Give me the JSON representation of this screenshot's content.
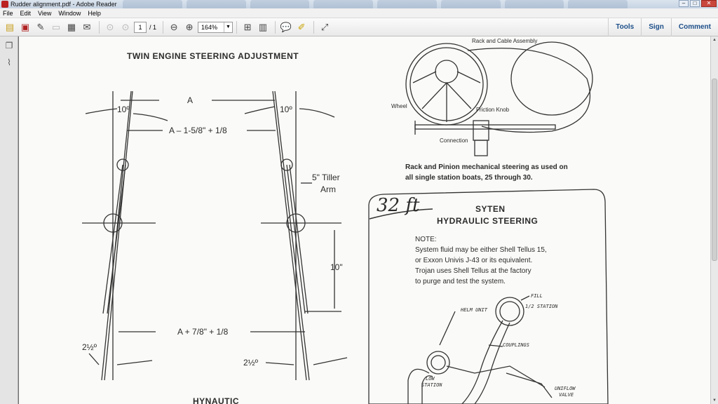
{
  "window": {
    "title": "Rudder alignment.pdf - Adobe Reader"
  },
  "menu": [
    "File",
    "Edit",
    "View",
    "Window",
    "Help"
  ],
  "toolbar": {
    "page_current": "1",
    "page_total": "/ 1",
    "zoom": "164%",
    "tools_label": "Tools",
    "sign_label": "Sign",
    "comment_label": "Comment"
  },
  "document": {
    "left_title": "TWIN ENGINE STEERING ADJUSTMENT",
    "dim_a": "A",
    "angle_top_left": "10º",
    "angle_top_right": "10º",
    "dim_a_minus": "A – 1-5/8\" + 1/8",
    "tiller_1": "5\" Tiller",
    "tiller_2": "Arm",
    "dim_10": "10\"",
    "dim_a_plus": "A + 7/8\" + 1/8",
    "angle_bottom_left": "2½º",
    "angle_bottom_right": "2½º",
    "bottom_cut": "HYNAUTIC",
    "rack_assembly": "Rack and Cable Assembly",
    "wheel": "Wheel",
    "friction_knob": "Friction Knob",
    "connection": "Connection",
    "rack_caption_1": "Rack and Pinion mechanical steering as used on",
    "rack_caption_2": "all single station boats, 25 through 30.",
    "handwritten": "32 ft",
    "box_title_1": "SYTEN",
    "box_title_2": "HYDRAULIC STEERING",
    "note_label": "NOTE:",
    "note_1": "System fluid may be either Shell Tellus 15,",
    "note_2": "or Exxon Univis J-43 or its equivalent.",
    "note_3": "Trojan uses Shell Tellus at the factory",
    "note_4": "to purge and test the system.",
    "fill": "FILL",
    "helm_unit": "HELM UNIT",
    "station_top": "1/2 STATION",
    "couplings": "COUPLINGS",
    "low_station_1": "LOW",
    "low_station_2": "STATION",
    "uniflow_1": "UNIFLOW",
    "uniflow_2": "VALVE"
  }
}
